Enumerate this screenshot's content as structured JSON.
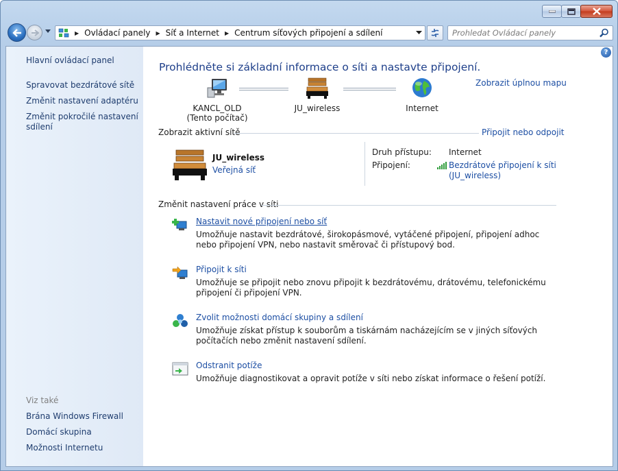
{
  "window": {
    "buttons": {
      "minimize": "minimize",
      "maximize": "maximize",
      "close": "close"
    }
  },
  "navbar": {
    "breadcrumbs": [
      "Ovládací panely",
      "Síť a Internet",
      "Centrum síťových připojení a sdílení"
    ],
    "search_placeholder": "Prohledat Ovládací panely"
  },
  "sidebar": {
    "home": "Hlavní ovládací panel",
    "links": [
      "Spravovat bezdrátové sítě",
      "Změnit nastavení adaptéru",
      "Změnit pokročilé nastavení sdílení"
    ],
    "see_also_label": "Viz také",
    "see_also": [
      "Brána Windows Firewall",
      "Domácí skupina",
      "Možnosti Internetu"
    ]
  },
  "main": {
    "title": "Prohlédněte si základní informace o síti a nastavte připojení.",
    "full_map_link": "Zobrazit úplnou mapu",
    "map": {
      "computer_name": "KANCL_OLD",
      "computer_sub": "(Tento počítač)",
      "network_name": "JU_wireless",
      "internet_label": "Internet"
    },
    "active_header": "Zobrazit aktivní sítě",
    "connect_link": "Připojit nebo odpojit",
    "active_network": {
      "name": "JU_wireless",
      "type": "Veřejná síť",
      "access_type_label": "Druh přístupu:",
      "access_type_value": "Internet",
      "connections_label": "Připojení:",
      "connections_value_line1": "Bezdrátové připojení k síti",
      "connections_value_line2": "(JU_wireless)"
    },
    "change_header": "Změnit nastavení práce v síti",
    "tasks": [
      {
        "title": "Nastavit nové připojení nebo síť",
        "desc": "Umožňuje nastavit bezdrátové, širokopásmové, vytáčené připojení, připojení adhoc nebo připojení VPN, nebo nastavit směrovač či přístupový bod.",
        "icon": "new-connection-icon"
      },
      {
        "title": "Připojit k síti",
        "desc": "Umožňuje se připojit nebo znovu připojit k bezdrátovému, drátovému, telefonickému připojení či připojení VPN.",
        "icon": "connect-network-icon"
      },
      {
        "title": "Zvolit možnosti domácí skupiny a sdílení",
        "desc": "Umožňuje získat přístup k souborům a tiskárnám nacházejícím se v jiných síťových počítačích nebo změnit nastavení sdílení.",
        "icon": "homegroup-icon"
      },
      {
        "title": "Odstranit potíže",
        "desc": "Umožňuje diagnostikovat a opravit potíže v síti nebo získat informace o řešení potíží.",
        "icon": "troubleshoot-icon"
      }
    ]
  },
  "colors": {
    "link": "#1c4ea3",
    "title": "#1e3f8a",
    "sidebar_bg": "#e6eff9",
    "frame": "#bcd3ec"
  }
}
